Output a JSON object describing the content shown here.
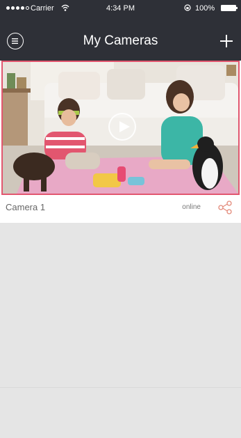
{
  "status_bar": {
    "carrier": "Carrier",
    "time": "4:34 PM",
    "battery": "100%",
    "icons": [
      "signal-icon",
      "wifi-icon",
      "orientation-lock-icon",
      "battery-icon"
    ]
  },
  "nav": {
    "title": "My Cameras",
    "menu_icon": "hamburger-menu-icon",
    "add_icon": "plus-icon"
  },
  "cameras": [
    {
      "name": "Camera 1",
      "status": "online",
      "share_icon": "share-icon",
      "play_icon": "play-icon"
    }
  ],
  "colors": {
    "header_bg": "#2e3037",
    "accent": "#e2566f",
    "empty_bg": "#e5e5e5"
  }
}
